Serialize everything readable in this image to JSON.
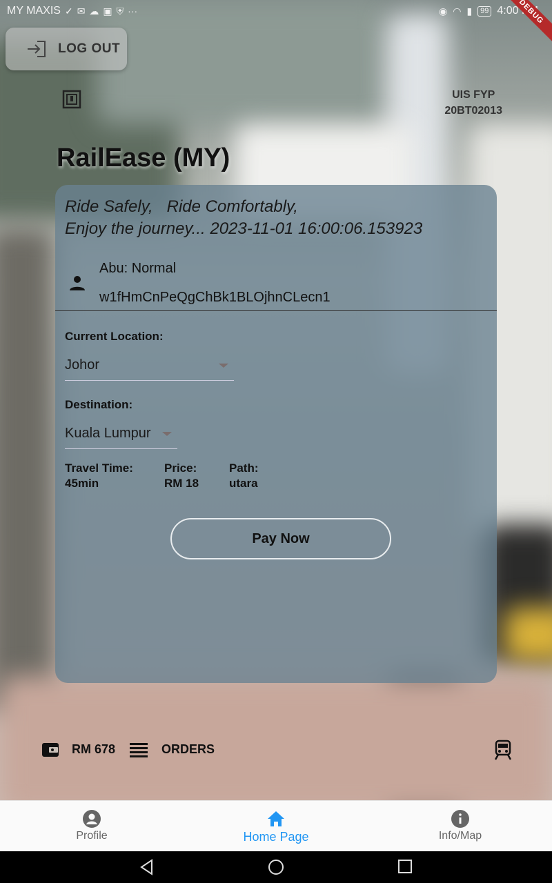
{
  "status_bar": {
    "carrier": "MY MAXIS",
    "battery": "99",
    "time": "4:00 PM",
    "debug_banner": "DEBUG"
  },
  "header": {
    "logout_label": "LOG OUT",
    "project_line1": "UIS FYP",
    "project_line2": "20BT02013",
    "app_title": "RailEase (MY)"
  },
  "card": {
    "slogan_line1": "Ride Safely,   Ride Comfortably,",
    "slogan_line2": "Enjoy the journey... 2023-11-01 16:00:06.153923",
    "user_name": "Abu: Normal",
    "user_id": "w1fHmCnPeQgChBk1BLOjhnCLecn1",
    "current_location_label": "Current Location:",
    "current_location_value": "Johor",
    "destination_label": "Destination:",
    "destination_value": "Kuala Lumpur",
    "travel_time_label": "Travel Time:",
    "travel_time_value": "45min",
    "price_label": "Price:",
    "price_value": "RM 18",
    "path_label": "Path:",
    "path_value": "utara",
    "pay_button": "Pay Now"
  },
  "bottom_strip": {
    "wallet_amount": "RM 678",
    "orders_label": "ORDERS"
  },
  "bottom_nav": {
    "items": [
      {
        "label": "Profile",
        "icon": "account-circle-icon"
      },
      {
        "label": "Home Page",
        "icon": "home-icon"
      },
      {
        "label": "Info/Map",
        "icon": "info-icon"
      }
    ],
    "active_index": 1
  },
  "colors": {
    "accent": "#2196f3",
    "card_bg": "#6a8291"
  }
}
